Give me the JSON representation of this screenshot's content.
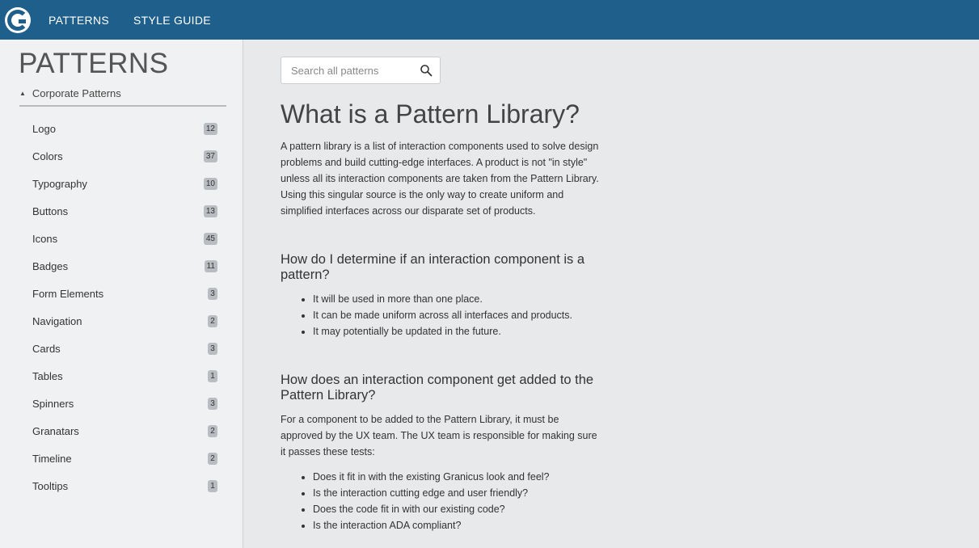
{
  "topbar": {
    "nav": [
      "PATTERNS",
      "STYLE GUIDE"
    ],
    "accent": "#1f5f8b"
  },
  "sidebar": {
    "title": "PATTERNS",
    "group": "Corporate Patterns",
    "items": [
      {
        "label": "Logo",
        "count": "12"
      },
      {
        "label": "Colors",
        "count": "37"
      },
      {
        "label": "Typography",
        "count": "10"
      },
      {
        "label": "Buttons",
        "count": "13"
      },
      {
        "label": "Icons",
        "count": "45"
      },
      {
        "label": "Badges",
        "count": "11"
      },
      {
        "label": "Form Elements",
        "count": "3"
      },
      {
        "label": "Navigation",
        "count": "2"
      },
      {
        "label": "Cards",
        "count": "3"
      },
      {
        "label": "Tables",
        "count": "1"
      },
      {
        "label": "Spinners",
        "count": "3"
      },
      {
        "label": "Granatars",
        "count": "2"
      },
      {
        "label": "Timeline",
        "count": "2"
      },
      {
        "label": "Tooltips",
        "count": "1"
      }
    ]
  },
  "search": {
    "placeholder": "Search all patterns",
    "value": ""
  },
  "main": {
    "title": "What is a Pattern Library?",
    "intro": "A pattern library is a list of interaction components used to solve design problems and build cutting-edge interfaces. A product is not \"in style\" unless all its interaction components are taken from the Pattern Library. Using this singular source is the only way to create uniform and simplified interfaces across our disparate set of products.",
    "section1": {
      "heading": "How do I determine if an interaction component is a pattern?",
      "bullets": [
        "It will be used in more than one place.",
        "It can be made uniform across all interfaces and products.",
        "It may potentially be updated in the future."
      ]
    },
    "section2": {
      "heading": "How does an interaction component get added to the Pattern Library?",
      "text": "For a component to be added to the Pattern Library, it must be approved by the UX team. The UX team is responsible for making sure it passes these tests:",
      "bullets": [
        "Does it fit in with the existing Granicus look and feel?",
        "Is the interaction cutting edge and user friendly?",
        "Does the code fit in with our existing code?",
        "Is the interaction ADA compliant?"
      ]
    }
  }
}
